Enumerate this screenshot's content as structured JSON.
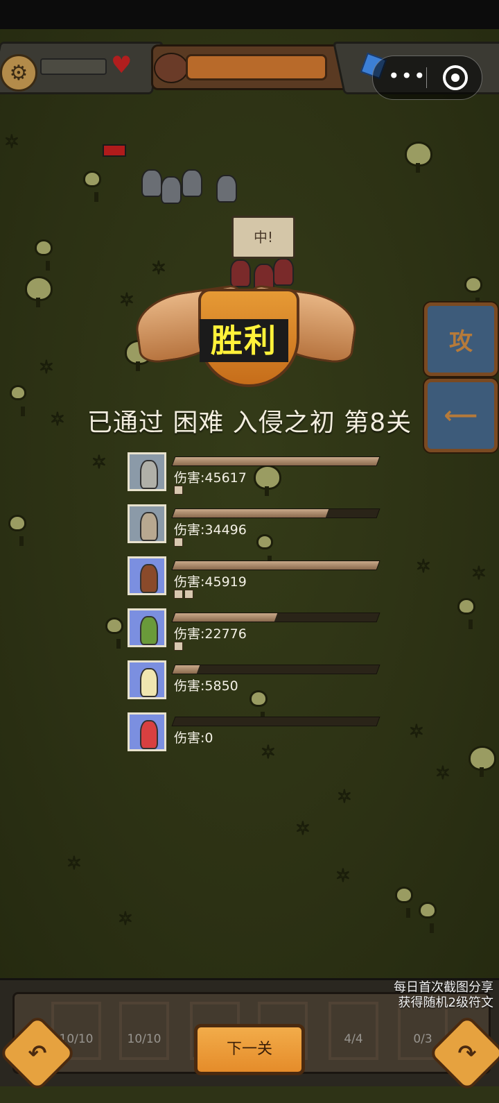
{
  "stage": {
    "victory_label": "胜利",
    "cleared_text": "已通过 困难 入侵之初 第8关",
    "enemy_speech": "中!"
  },
  "side_buttons": {
    "attack_glyph": "攻"
  },
  "damage_rows": [
    {
      "label": "伤害:45617",
      "fraction": 1.0,
      "portrait": "gray-soldier",
      "bg": "gray"
    },
    {
      "label": "伤害:34496",
      "fraction": 0.75,
      "portrait": "archer",
      "bg": "gray"
    },
    {
      "label": "伤害:45919",
      "fraction": 1.0,
      "portrait": "cavalry",
      "bg": "blue"
    },
    {
      "label": "伤害:22776",
      "fraction": 0.5,
      "portrait": "elf-archer",
      "bg": "blue"
    },
    {
      "label": "伤害:5850",
      "fraction": 0.12,
      "portrait": "priestess",
      "bg": "blue"
    },
    {
      "label": "伤害:0",
      "fraction": 0.0,
      "portrait": "drummer",
      "bg": "blue"
    }
  ],
  "bottom": {
    "next_level_label": "下一关",
    "slots": [
      "10/10",
      "10/10",
      "",
      "",
      "4/4",
      "0/3"
    ],
    "share_line1": "每日首次截图分享",
    "share_line2": "获得随机2级符文"
  },
  "colors": {
    "bar_fill": "#c9a98a",
    "victory_text": "#fff23a",
    "background": "#2e3316"
  }
}
